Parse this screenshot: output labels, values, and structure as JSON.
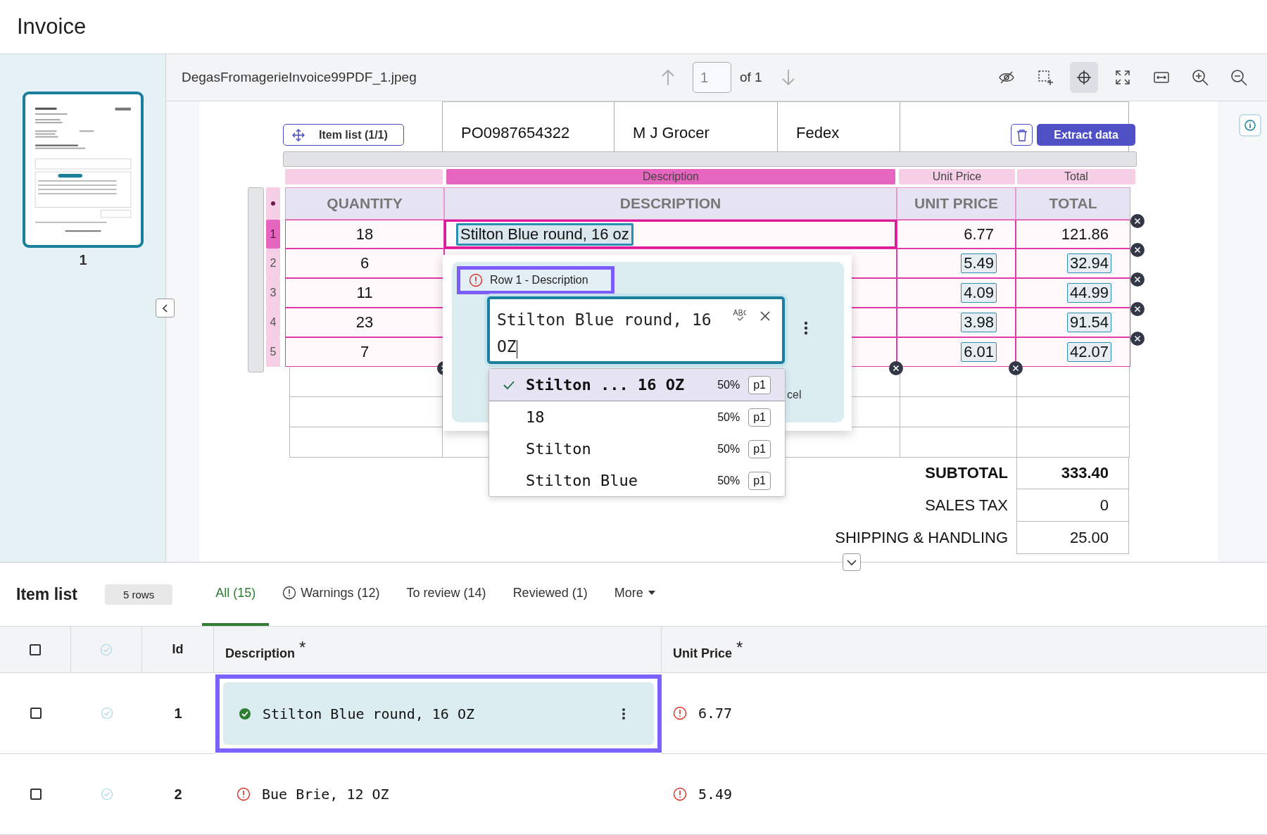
{
  "page_title": "Invoice",
  "thumbnails": [
    {
      "label": "1",
      "selected": true
    }
  ],
  "viewer": {
    "file_name": "DegasFromagerieInvoice99PDF_1.jpeg",
    "page_input": "1",
    "page_total": "of 1",
    "tools": [
      {
        "kind": "hide",
        "selected": false
      },
      {
        "kind": "select-area",
        "selected": false
      },
      {
        "kind": "crosshair",
        "selected": true
      },
      {
        "kind": "fullscreen",
        "selected": false
      },
      {
        "kind": "fit-width",
        "selected": false
      },
      {
        "kind": "zoom-in",
        "selected": false
      },
      {
        "kind": "zoom-out",
        "selected": false
      }
    ]
  },
  "document": {
    "region_button": "Item list (1/1)",
    "extract_button": "Extract data",
    "info_row": [
      "PO0987654322",
      "M J Grocer",
      "Fedex"
    ],
    "column_labels": [
      {
        "label": "Description",
        "selected": true
      },
      {
        "label": "Unit Price",
        "selected": false
      },
      {
        "label": "Total",
        "selected": false
      }
    ],
    "table_headers": [
      "QUANTITY",
      "DESCRIPTION",
      "UNIT PRICE",
      "TOTAL"
    ],
    "rows": [
      {
        "number": "1",
        "selected": true,
        "quantity": "18",
        "description": "Stilton Blue round, 16 oz",
        "unit_price": "6.77",
        "total": "121.86",
        "boxed": false
      },
      {
        "number": "2",
        "selected": false,
        "quantity": "6",
        "unit_price": "5.49",
        "total": "32.94",
        "boxed": true
      },
      {
        "number": "3",
        "selected": false,
        "quantity": "11",
        "unit_price": "4.09",
        "total": "44.99",
        "boxed": true
      },
      {
        "number": "4",
        "selected": false,
        "quantity": "23",
        "unit_price": "3.98",
        "total": "91.54",
        "boxed": true
      },
      {
        "number": "5",
        "selected": false,
        "quantity": "7",
        "unit_price": "6.01",
        "total": "42.07",
        "boxed": true
      }
    ],
    "totals": [
      {
        "label": "SUBTOTAL",
        "value": "333.40",
        "emphasized": true
      },
      {
        "label": "SALES TAX",
        "value": "0",
        "emphasized": false
      },
      {
        "label": "SHIPPING & HANDLING",
        "value": "25.00",
        "emphasized": false
      }
    ],
    "popover": {
      "field_label": "Row 1 - Description",
      "value": "Stilton Blue round, 16 OZ",
      "cancel_partial": "cel",
      "suggestions": [
        {
          "text": "Stilton ... 16 OZ",
          "confidence": "50%",
          "page": "p1",
          "selected": true
        },
        {
          "text": "18",
          "confidence": "50%",
          "page": "p1",
          "selected": false
        },
        {
          "text": "Stilton",
          "confidence": "50%",
          "page": "p1",
          "selected": false
        },
        {
          "text": "Stilton Blue",
          "confidence": "50%",
          "page": "p1",
          "selected": false
        }
      ]
    }
  },
  "item_list": {
    "title": "Item list",
    "row_count": "5 rows",
    "tabs": [
      {
        "label": "All (15)",
        "kind": "plain",
        "selected": true
      },
      {
        "label": "Warnings (12)",
        "kind": "warning",
        "selected": false
      },
      {
        "label": "To review (14)",
        "kind": "plain",
        "selected": false
      },
      {
        "label": "Reviewed (1)",
        "kind": "plain",
        "selected": false
      },
      {
        "label": "More",
        "kind": "menu",
        "selected": false
      }
    ],
    "all_checked": false,
    "columns": [
      {
        "label": "Id"
      },
      {
        "label": "Description",
        "required_mark": "*"
      },
      {
        "label": "Unit Price",
        "required_mark": "*"
      }
    ],
    "rows": [
      {
        "checked": false,
        "id": "1",
        "description": "Stilton Blue round, 16 OZ",
        "description_flagged": false,
        "description_selected": true,
        "unit_price": "6.77",
        "unit_price_flagged": true
      },
      {
        "checked": false,
        "id": "2",
        "description": "Bue Brie, 12 OZ",
        "description_flagged": true,
        "description_selected": false,
        "unit_price": "5.49",
        "unit_price_flagged": true
      }
    ]
  }
}
